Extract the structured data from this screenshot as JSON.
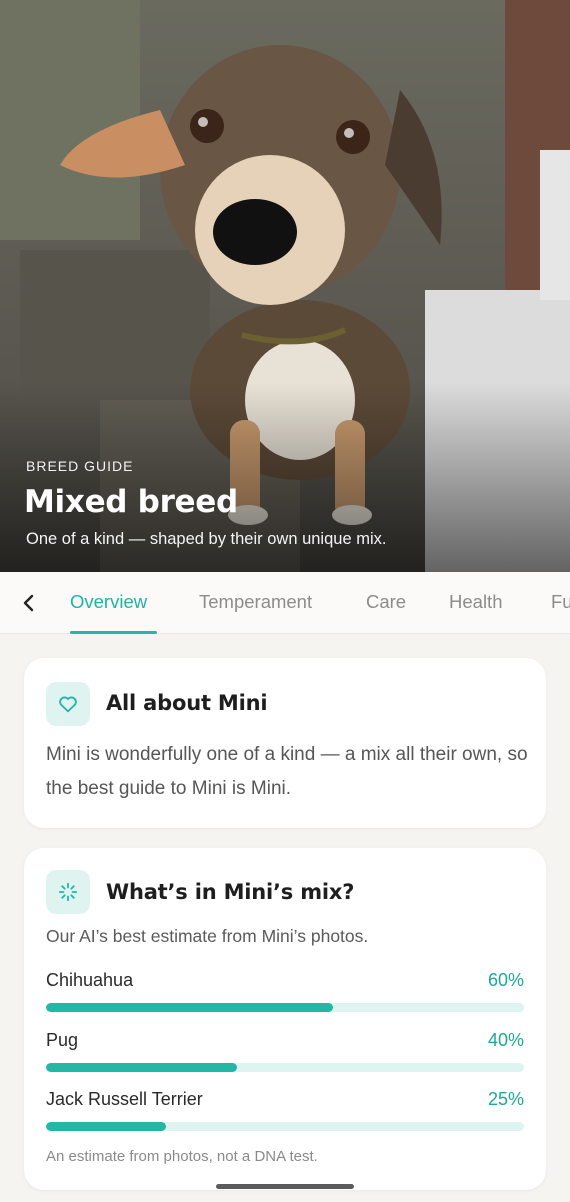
{
  "hero": {
    "eyebrow": "BREED GUIDE",
    "title": "Mixed breed",
    "subtitle": "One of a kind — shaped by their own unique mix."
  },
  "tabs": {
    "items": [
      {
        "label": "Overview",
        "active": true
      },
      {
        "label": "Temperament",
        "active": false
      },
      {
        "label": "Care",
        "active": false
      },
      {
        "label": "Health",
        "active": false
      },
      {
        "label": "Fu",
        "active": false
      }
    ]
  },
  "about": {
    "title": "All about Mini",
    "body": "Mini is wonderfully one of a kind — a mix all their own, so the best guide to Mini is Mini."
  },
  "mix": {
    "title": "What’s in Mini’s mix?",
    "lead": "Our AI’s best estimate from Mini’s photos.",
    "breeds": [
      {
        "name": "Chihuahua",
        "percent_label": "60%",
        "percent": 60
      },
      {
        "name": "Pug",
        "percent_label": "40%",
        "percent": 40
      },
      {
        "name": "Jack Russell Terrier",
        "percent_label": "25%",
        "percent": 25
      }
    ],
    "note": "An estimate from photos, not a DNA test."
  },
  "colors": {
    "accent": "#22b8a5",
    "accent_light": "#ddf4f0",
    "background": "#f6f4f1"
  },
  "icons": {
    "back": "chevron-left-icon",
    "about": "heart-icon",
    "mix": "sparkle-icon"
  }
}
